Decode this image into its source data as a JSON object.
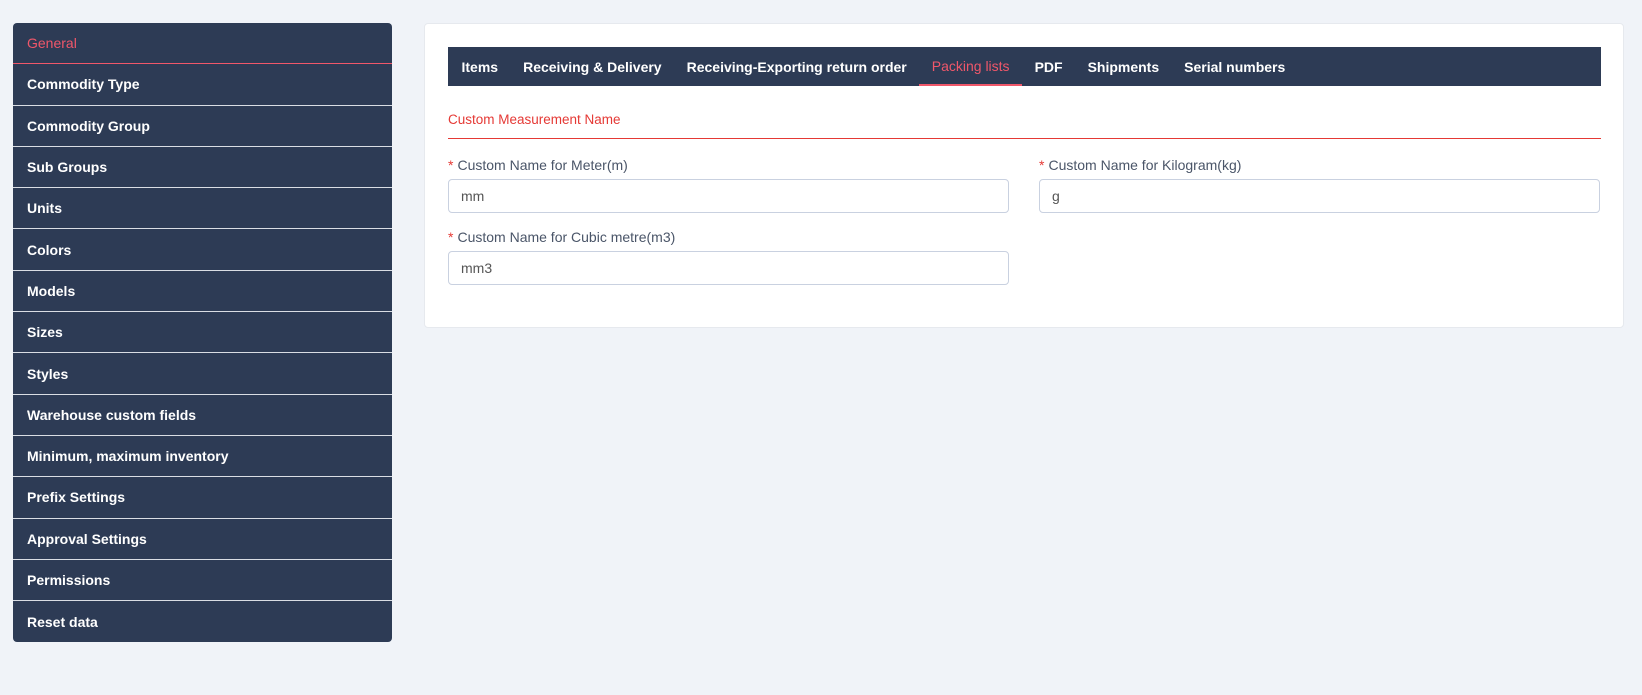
{
  "sidebar": {
    "items": [
      {
        "label": "General"
      },
      {
        "label": "Commodity Type"
      },
      {
        "label": "Commodity Group"
      },
      {
        "label": "Sub Groups"
      },
      {
        "label": "Units"
      },
      {
        "label": "Colors"
      },
      {
        "label": "Models"
      },
      {
        "label": "Sizes"
      },
      {
        "label": "Styles"
      },
      {
        "label": "Warehouse custom fields"
      },
      {
        "label": "Minimum, maximum inventory"
      },
      {
        "label": "Prefix Settings"
      },
      {
        "label": "Approval Settings"
      },
      {
        "label": "Permissions"
      },
      {
        "label": "Reset data"
      }
    ],
    "active_index": 0
  },
  "tabs": {
    "items": [
      {
        "label": "Items"
      },
      {
        "label": "Receiving & Delivery"
      },
      {
        "label": "Receiving-Exporting return order"
      },
      {
        "label": "Packing lists"
      },
      {
        "label": "PDF"
      },
      {
        "label": "Shipments"
      },
      {
        "label": "Serial numbers"
      }
    ],
    "active_index": 3
  },
  "section": {
    "title": "Custom Measurement Name"
  },
  "form": {
    "required_marker": "*",
    "meter": {
      "label": "Custom Name for Meter(m)",
      "value": "mm"
    },
    "kilogram": {
      "label": "Custom Name for Kilogram(kg)",
      "value": "g"
    },
    "cubic": {
      "label": "Custom Name for Cubic metre(m3)",
      "value": "mm3"
    }
  },
  "colors": {
    "nav_background": "#2d3b55",
    "accent": "#f0576a",
    "section_accent": "#e53935",
    "page_background": "#f0f3f8"
  }
}
